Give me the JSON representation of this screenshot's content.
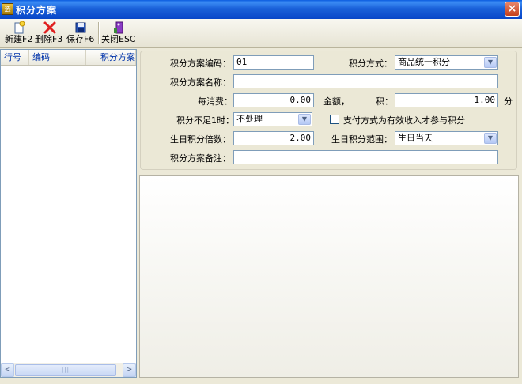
{
  "window": {
    "title": "积分方案",
    "app_icon_text": "选",
    "close_glyph": "×"
  },
  "toolbar": {
    "new_label": "新建F2",
    "delete_label": "删除F3",
    "save_label": "保存F6",
    "close_label": "关闭ESC"
  },
  "grid": {
    "columns": [
      "行号",
      "编码",
      "积分方案名称"
    ],
    "rows": []
  },
  "scrollbar": {
    "left_arrow": "<",
    "right_arrow": ">",
    "thumb_grip": "|||"
  },
  "form": {
    "code_label": "积分方案编码：",
    "code_value": "01",
    "method_label": "积分方式：",
    "method_value": "商品统一积分",
    "name_label": "积分方案名称：",
    "name_value": "",
    "per_spend_label": "每消费：",
    "per_spend_value": "0.00",
    "amount_label": "金额，",
    "points_label": "积：",
    "points_value": "1.00",
    "points_unit": "分",
    "shortfall_label": "积分不足1时：",
    "shortfall_value": "不处理",
    "valid_income_label": "支付方式为有效收入才参与积分",
    "birthday_multiple_label": "生日积分倍数：",
    "birthday_multiple_value": "2.00",
    "birthday_range_label": "生日积分范围：",
    "birthday_range_value": "生日当天",
    "remark_label": "积分方案备注：",
    "remark_value": ""
  },
  "colors": {
    "titlebar": "#0a5be0",
    "header_text": "#0033aa",
    "input_border": "#7f9db9"
  }
}
